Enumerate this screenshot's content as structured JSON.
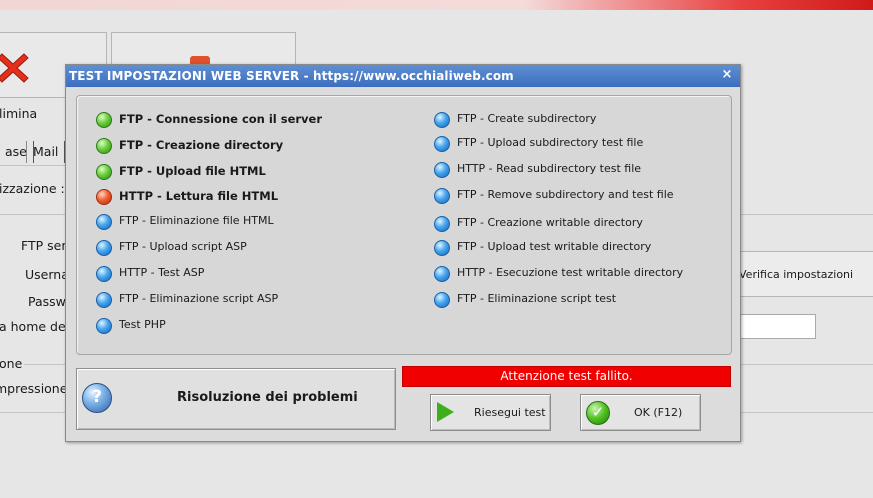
{
  "background": {
    "labels": {
      "elimina": "limina",
      "tab_base": "ase",
      "tab_mail": "Mail",
      "organizzazione": "izzazione :",
      "ftp_server": "FTP ser",
      "username": "Userna",
      "password": "Passw",
      "home_dir": "a home del",
      "section_one": "one",
      "compressione": "mpressione",
      "verifica_button": "Verifica impostazioni"
    }
  },
  "dialog": {
    "title": "TEST IMPOSTAZIONI WEB SERVER - https://www.occhialiweb.com",
    "close_symbol": "×",
    "tests_left": [
      {
        "label": "FTP - Connessione con il server",
        "status": "ok"
      },
      {
        "label": "FTP - Creazione directory",
        "status": "ok"
      },
      {
        "label": "FTP - Upload file HTML",
        "status": "ok"
      },
      {
        "label": "HTTP - Lettura file HTML",
        "status": "failed"
      },
      {
        "label": "FTP - Eliminazione file HTML",
        "status": "pending"
      },
      {
        "label": "FTP - Upload script ASP",
        "status": "pending"
      },
      {
        "label": "HTTP - Test ASP",
        "status": "pending"
      },
      {
        "label": "FTP - Eliminazione script ASP",
        "status": "pending"
      },
      {
        "label": "Test PHP",
        "status": "pending"
      }
    ],
    "tests_right": [
      {
        "label": "FTP - Create subdirectory",
        "status": "pending"
      },
      {
        "label": "FTP - Upload subdirectory test file",
        "status": "pending"
      },
      {
        "label": "HTTP - Read subdirectory test file",
        "status": "pending"
      },
      {
        "label": "FTP - Remove subdirectory and test file",
        "status": "pending"
      },
      {
        "label": "FTP - Creazione writable directory",
        "status": "pending"
      },
      {
        "label": "FTP - Upload test writable directory",
        "status": "pending"
      },
      {
        "label": "HTTP - Esecuzione test writable directory",
        "status": "pending"
      },
      {
        "label": "FTP - Eliminazione script test",
        "status": "pending"
      }
    ],
    "help_button": {
      "label": "Risoluzione dei problemi",
      "icon": "question-icon",
      "icon_text": "?"
    },
    "status_message": "Attenzione test fallito.",
    "retry_button": {
      "label": "Riesegui test",
      "icon": "play-icon"
    },
    "ok_button": {
      "label": "OK (F12)",
      "icon": "checkmark-icon",
      "icon_text": "✓"
    }
  },
  "colors": {
    "status_bar": "#f00000",
    "title_bar": "#3c6ebf",
    "ok_dot": "#4cb82a",
    "failed_dot": "#e0441c",
    "pending_dot": "#2f8be0"
  }
}
